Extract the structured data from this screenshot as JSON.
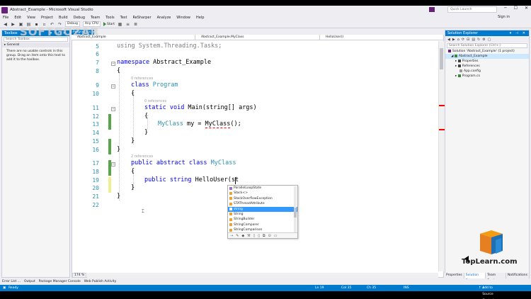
{
  "window": {
    "title": "Abstract_Example - Microsoft Visual Studio",
    "quick_launch_placeholder": "Quick Launch",
    "sign_in": "Sign in"
  },
  "menu": [
    "File",
    "Edit",
    "View",
    "Project",
    "Build",
    "Debug",
    "Team",
    "Tools",
    "Test",
    "ReSharper",
    "Analyze",
    "Window",
    "Help"
  ],
  "toolbar": {
    "config": "Debug",
    "platform": "Any CPU",
    "start": "Start"
  },
  "toolbox": {
    "title": "Toolbox",
    "search_placeholder": "Search Toolbox",
    "group": "General",
    "empty_message": "There are no usable controls in this group. Drag an item onto this text to add it to the toolbox."
  },
  "editor": {
    "tab": "Program.cs",
    "nav_project": "Abstract_Example",
    "nav_class": "Abstract_Example.MyClass",
    "nav_member": "HelloUser()",
    "zoom": "174 %",
    "line_numbers": [
      "5",
      "6",
      "7",
      "8",
      "9",
      "10",
      "11",
      "12",
      "13",
      "14",
      "15",
      "16",
      "17",
      "18",
      "19",
      "20",
      "21",
      "22"
    ],
    "refs_0": "0 references",
    "refs_0b": "0 references",
    "refs_2": "2 references",
    "code": {
      "l5": "using System.Threading.Tasks;",
      "kw_namespace": "namespace",
      "ns_name": " Abstract_Example",
      "brace_open": "{",
      "brace_close": "}",
      "kw_class": "class",
      "program": " Program",
      "kw_static": "static",
      "kw_void": " void",
      "main_sig": " Main(string[] args)",
      "myclass_type": "MyClass",
      "l13_mid": " my = ",
      "l13_new": "MyClass",
      "l13_end": "();",
      "kw_public": "public",
      "kw_abstract": " abstract",
      "kw_class2": " class",
      "myclass_name": " MyClass",
      "kw_string": " string",
      "l19_rest": " HelloUser(st"
    }
  },
  "intellisense": {
    "items": [
      "ParallelLoopState",
      "Stack<>",
      "StackOverflowException",
      "STAThreadAttribute",
      "string",
      "String",
      "StringBuilder",
      "StringComparer",
      "StringComparison"
    ],
    "selected_index": 4
  },
  "solution_explorer": {
    "title": "Solution Explorer",
    "search_placeholder": "Search Solution Explorer (Ctrl+;)",
    "tree": [
      "Solution 'Abstract_Example' (1 project)",
      "Abstract_Example",
      "Properties",
      "References",
      "App.config",
      "Program.cs"
    ],
    "tabs": [
      "Properties",
      "Solution Ex...",
      "Team Expl...",
      "Notifications"
    ]
  },
  "bottom_tabs": [
    "Error List ...",
    "Output",
    "Package Manager Console",
    "Web Publish Activity"
  ],
  "status": {
    "state": "Ready",
    "line": "Ln 19",
    "col": "Col 35",
    "ch": "Ch 35",
    "mode": "INS",
    "source_control": "Add to Source Control"
  },
  "watermark": {
    "left": "SOFTGOZAR",
    "brand": "TopLearn.com"
  },
  "colors": {
    "accent": "#007acc",
    "keyword": "#0000ff",
    "type": "#2b91af",
    "selection": "#3399ff"
  }
}
